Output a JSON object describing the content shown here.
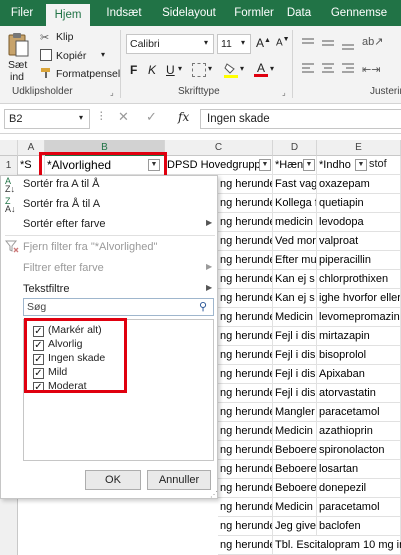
{
  "tabs": [
    "Filer",
    "Hjem",
    "Indsæt",
    "Sidelayout",
    "Formler",
    "Data",
    "Gennemse"
  ],
  "ribbon": {
    "paste_label_1": "Sæt",
    "paste_label_2": "ind",
    "cut": "Klip",
    "copy": "Kopiér",
    "format_painter": "Formatpensel",
    "clipboard_group": "Udklipsholder",
    "font_name": "Calibri",
    "font_size": "11",
    "font_group": "Skrifttype",
    "bold": "F",
    "italic": "K",
    "underline": "U",
    "align_group": "Justerin"
  },
  "formula_bar": {
    "name_box": "B2",
    "fx": "fx",
    "value": "Ingen skade"
  },
  "columns": [
    "A",
    "B",
    "C",
    "D",
    "E"
  ],
  "header_row": {
    "row_num": "1",
    "a": "*S",
    "b": "*Alvorlighed",
    "c": "DPSD Hovedgruppe",
    "d": "*Hæn",
    "e": "*Indho",
    "e2": "stof"
  },
  "rows": [
    {
      "c": "ng herunde",
      "d": "Fast vagt",
      "e": "oxazepam"
    },
    {
      "c": "ng herunde",
      "d": "Kollega f",
      "e": "quetiapin"
    },
    {
      "c": "ng herunde",
      "d": "medicin",
      "e": "levodopa"
    },
    {
      "c": "ng herunde",
      "d": "Ved mor",
      "e": "valproat"
    },
    {
      "c": "ng herunde",
      "d": "Efter mu",
      "e": "piperacillin"
    },
    {
      "c": "ng herunde",
      "d": "Kan ej s",
      "e": "chlorprothixen"
    },
    {
      "c": "ng herunde",
      "d": "Kan ej s",
      "e": "ighe hvorfor eller h"
    },
    {
      "c": "ng herunde",
      "d": "Medicin",
      "e": "levomepromazin"
    },
    {
      "c": "ng herunde",
      "d": "Fejl i dis",
      "e": "mirtazapin"
    },
    {
      "c": "ng herunde",
      "d": "Fejl i dis",
      "e": "bisoprolol"
    },
    {
      "c": "ng herunde",
      "d": "Fejl i dis",
      "e": "Apixaban"
    },
    {
      "c": "ng herunde",
      "d": "Fejl i dis",
      "e": "atorvastatin"
    },
    {
      "c": "ng herunde",
      "d": "Mangler",
      "e": "paracetamol"
    },
    {
      "c": "ng herunde",
      "d": "Medicin",
      "e": "azathioprin"
    },
    {
      "c": "ng herunde",
      "d": "Beboere",
      "e": "spironolacton"
    },
    {
      "c": "ng herunde",
      "d": "Beboere",
      "e": "losartan"
    },
    {
      "c": "ng herunde",
      "d": "Beboere",
      "e": "donepezil"
    },
    {
      "c": "ng herunde",
      "d": "Medicin",
      "e": "paracetamol"
    },
    {
      "c": "ng herunde",
      "d": "Jeg give",
      "e": "baclofen"
    },
    {
      "c": "ng herunde",
      "d": "Tbl. Escitalopram 10 mg ir",
      "e": ""
    }
  ],
  "menu": {
    "sort_asc": "Sortér fra A til Å",
    "sort_desc": "Sortér fra Å til A",
    "sort_color": "Sortér efter farve",
    "clear_filter": "Fjern filter fra \"*Alvorlighed\"",
    "filter_color": "Filtrer efter farve",
    "text_filters": "Tekstfiltre",
    "search_placeholder": "Søg",
    "options": [
      "(Markér alt)",
      "Alvorlig",
      "Ingen skade",
      "Mild",
      "Moderat"
    ],
    "ok": "OK",
    "cancel": "Annuller"
  },
  "colors": {
    "brand_green": "#217346",
    "highlight_red": "#e0000f"
  }
}
